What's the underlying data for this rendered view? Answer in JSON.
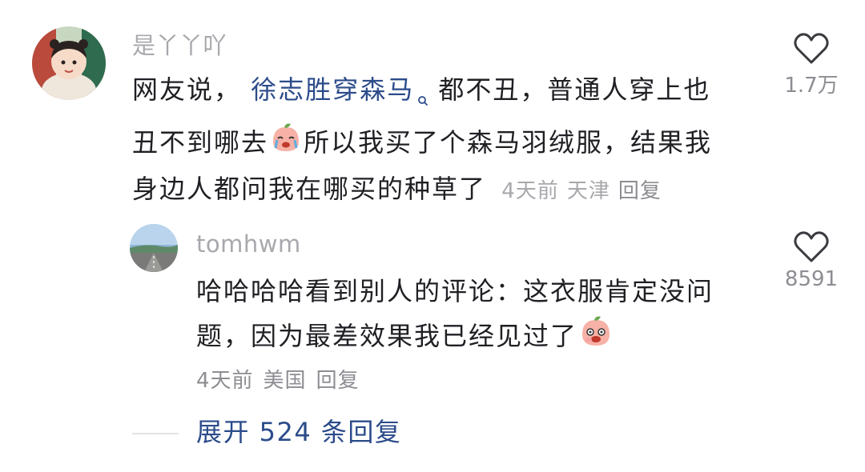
{
  "comment1": {
    "username": "是丫丫吖",
    "line1_prefix": "网友说，",
    "line1_link": "徐志胜穿森马",
    "line1_suffix": "都不丑，普通人穿上也",
    "line2_a": "丑不到哪去",
    "line2_b": "所以我买了个森马羽绒服，结果我",
    "line3": "身边人都问我在哪买的种草了",
    "time": "4天前",
    "location": "天津",
    "reply": "回复",
    "likes": "1.7万"
  },
  "comment2": {
    "username": "tomhwm",
    "line1": "哈哈哈哈看到别人的评论：这衣服肯定没问",
    "line2": "题，因为最差效果我已经见过了",
    "time": "4天前",
    "location": "美国",
    "reply": "回复",
    "likes": "8591"
  },
  "expand_replies": "展开 524 条回复",
  "icons": {
    "like": "heart-outline-icon",
    "search": "search-icon",
    "emoji_cry": "crying-emoji-icon",
    "emoji_laugh": "laughing-emoji-icon"
  }
}
